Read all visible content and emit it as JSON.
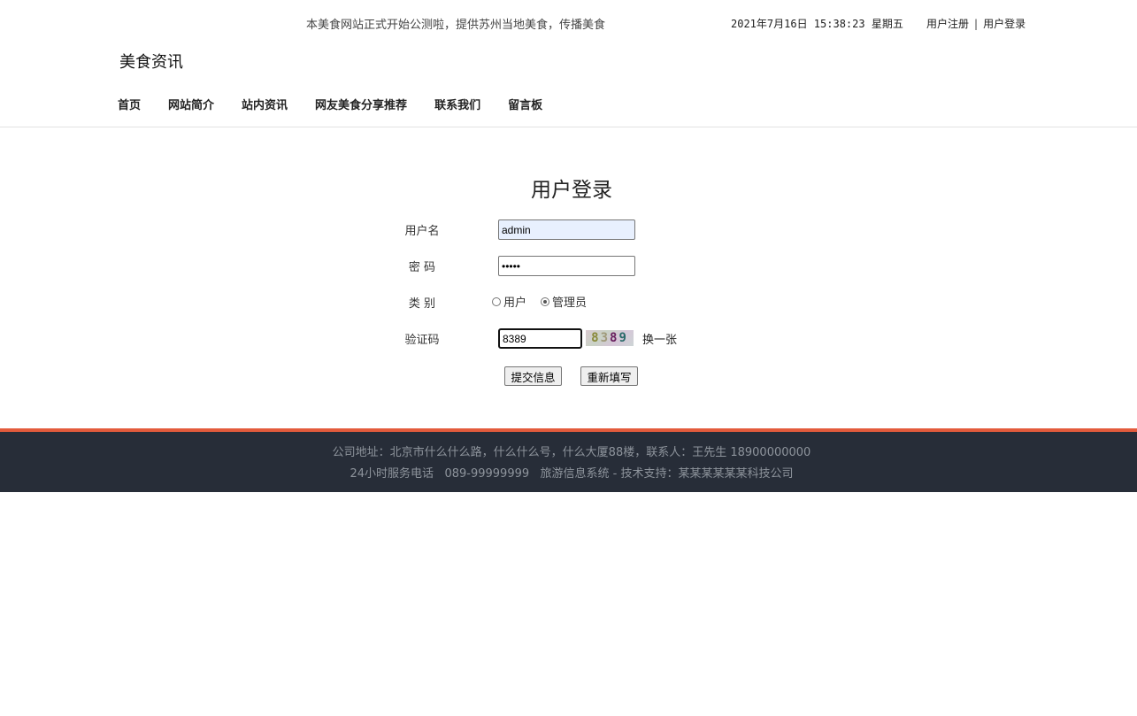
{
  "header": {
    "announcement": "本美食网站正式开始公测啦，提供苏州当地美食，传播美食",
    "datetime": "2021年7月16日 15:38:23 星期五",
    "register_label": "用户注册",
    "separator": "|",
    "login_label": "用户登录",
    "site_title": "美食资讯"
  },
  "nav": {
    "items": [
      {
        "label": "首页"
      },
      {
        "label": "网站简介"
      },
      {
        "label": "站内资讯"
      },
      {
        "label": "网友美食分享推荐"
      },
      {
        "label": "联系我们"
      },
      {
        "label": "留言板"
      }
    ]
  },
  "login_form": {
    "title": "用户登录",
    "username_label": "用户名",
    "username_value": "admin",
    "password_label": "密 码",
    "password_value": "•••••",
    "category_label": "类 别",
    "category_options": [
      {
        "label": "用户",
        "selected": false
      },
      {
        "label": "管理员",
        "selected": true
      }
    ],
    "captcha_label": "验证码",
    "captcha_value": "8389",
    "captcha_image_text": [
      "8",
      "3",
      "8",
      "9"
    ],
    "refresh_label": "换一张",
    "submit_label": "提交信息",
    "reset_label": "重新填写"
  },
  "footer": {
    "line1": "公司地址：北京市什么什么路，什么什么号，什么大厦88楼，联系人：王先生 18900000000",
    "line2": "24小时服务电话   089-99999999   旅游信息系统 - 技术支持：某某某某某某科技公司"
  },
  "colors": {
    "footer_bg": "#272d38",
    "footer_accent": "#e35b3c",
    "autofill_bg": "#e8f0fe"
  }
}
